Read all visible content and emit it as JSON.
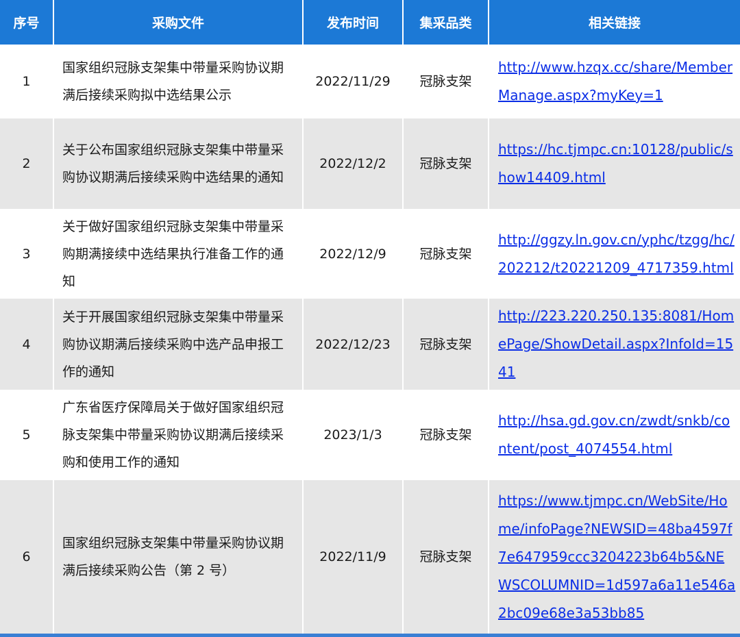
{
  "table": {
    "headers": [
      "序号",
      "采购文件",
      "发布时间",
      "集采品类",
      "相关链接"
    ],
    "rows": [
      {
        "no": "1",
        "doc": "国家组织冠脉支架集中带量采购协议期满后接续采购拟中选结果公示",
        "date": "2022/11/29",
        "category": "冠脉支架",
        "link": "http://www.hzqx.cc/share/MemberManage.aspx?myKey=1"
      },
      {
        "no": "2",
        "doc": "关于公布国家组织冠脉支架集中带量采购协议期满后接续采购中选结果的通知",
        "date": "2022/12/2",
        "category": "冠脉支架",
        "link": "https://hc.tjmpc.cn:10128/public/show14409.html"
      },
      {
        "no": "3",
        "doc": "关于做好国家组织冠脉支架集中带量采购期满接续中选结果执行准备工作的通知",
        "date": "2022/12/9",
        "category": "冠脉支架",
        "link": "http://ggzy.ln.gov.cn/yphc/tzgg/hc/202212/t20221209_4717359.html"
      },
      {
        "no": "4",
        "doc": "关于开展国家组织冠脉支架集中带量采购协议期满后接续采购中选产品申报工作的通知",
        "date": "2022/12/23",
        "category": "冠脉支架",
        "link": "http://223.220.250.135:8081/HomePage/ShowDetail.aspx?InfoId=1541"
      },
      {
        "no": "5",
        "doc": "广东省医疗保障局关于做好国家组织冠脉支架集中带量采购协议期满后接续采购和使用工作的通知",
        "date": "2023/1/3",
        "category": "冠脉支架",
        "link": "http://hsa.gd.gov.cn/zwdt/snkb/content/post_4074554.html"
      },
      {
        "no": "6",
        "doc": "国家组织冠脉支架集中带量采购协议期满后接续采购公告（第 2 号）",
        "date": "2022/11/9",
        "category": "冠脉支架",
        "link": "https://www.tjmpc.cn/WebSite/Home/infoPage?NEWSID=48ba4597f7e647959ccc3204223b64b5&NEWSCOLUMNID=1d597a6a11e546a2bc09e68e3a53bb85"
      }
    ]
  }
}
